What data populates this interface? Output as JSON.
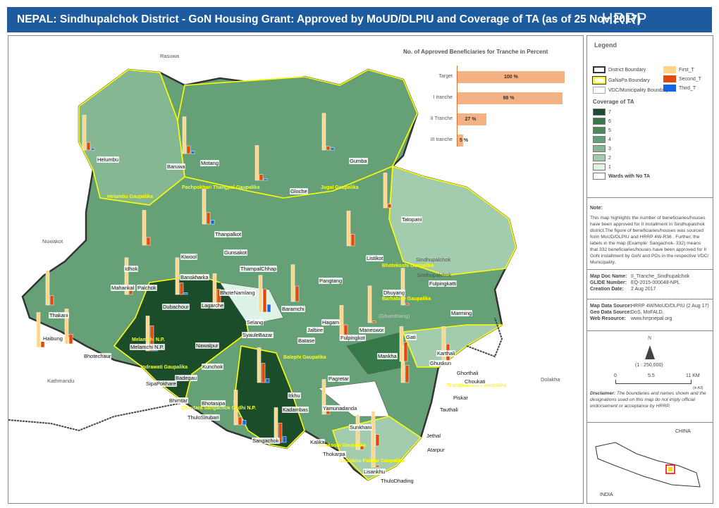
{
  "header": {
    "title": "NEPAL: Sindhupalchok District - GoN Housing Grant: Approved by MoUD/DLPIU and Coverage of TA (as of 25 Nov 2017)",
    "logo": "HRRP"
  },
  "chart_data": {
    "type": "bar",
    "title": "No. of Approved Beneficiaries for Tranche in Percent",
    "categories": [
      "Target",
      "I tranche",
      "II Tranche",
      "III tranche"
    ],
    "values": [
      100,
      98,
      27,
      5
    ],
    "value_labels": [
      "100 %",
      "98 %",
      "27 %",
      "5 %"
    ],
    "orientation": "horizontal",
    "color": "#f4b183",
    "xlim": [
      0,
      100
    ]
  },
  "legend": {
    "title": "Legend",
    "boundaries": [
      "District Boundary",
      "GaNaPa Boundary",
      "VDC/Municipality Boundary"
    ],
    "tranches": [
      {
        "label": "First_T",
        "color": "#ffd58a"
      },
      {
        "label": "Second_T",
        "color": "#e34a0a"
      },
      {
        "label": "Third_T",
        "color": "#1565e0"
      }
    ],
    "coverage_title": "Coverage of TA",
    "coverage": [
      {
        "label": "7",
        "color": "#1b4d2a"
      },
      {
        "label": "6",
        "color": "#357a48"
      },
      {
        "label": "5",
        "color": "#4a8a5c"
      },
      {
        "label": "4",
        "color": "#66a077"
      },
      {
        "label": "3",
        "color": "#85b792"
      },
      {
        "label": "2",
        "color": "#a3cbad"
      },
      {
        "label": "1",
        "color": "#def3e7"
      },
      {
        "label": "Wards with No TA",
        "color": "#ffffff"
      }
    ]
  },
  "note": {
    "title": "Note:",
    "text": "This map highlights the number of beneficiaries/houses have been approved for II installment in Sindhupalchok district.The figure of beneficiaries/houses was sourced form MoUD/DLPIU and HRRP 4W-R36 . Further, the labels in the map (Example: Sangachok- 332) means that 332 beneficiaries/houses have been approved for II GoN installment by GoN and POs in the respective VDC/ Municipality."
  },
  "meta": [
    {
      "k": "Map Doc Name:",
      "v": "II_Tranche_Sindhupalchok"
    },
    {
      "k": "GLIDE Number:",
      "v": "EQ-2015-000048-NPL"
    },
    {
      "k": "Creation Date:",
      "v": "2 Aug 2017"
    }
  ],
  "source": [
    {
      "k": "Map Data Source:",
      "v": "HRRP 4W/MoUD/DLPIU (2 Aug 17)"
    },
    {
      "k": "Geo Data Source:",
      "v": "DoS, MoFALD."
    },
    {
      "k": "Web Resource:",
      "v": "www.hrrpnepal.org"
    }
  ],
  "scale": {
    "north": "N",
    "ratio": "(1 : 250,000)",
    "ticks": [
      "0",
      "5.5",
      "11 KM"
    ],
    "paper": "(in A3)"
  },
  "disclaimer": {
    "title": "Disclaimer:",
    "text": "The boundaries and names shown and the designations used on this map do not imply official endorsement or acceptance by HRRP."
  },
  "inset": {
    "north": "CHINA",
    "south": "INDIA"
  },
  "regions": [
    "Rasuwa",
    "Nuwakot",
    "Kathmandu",
    "Dolakha",
    "Sindhupalchok"
  ],
  "gaunpalikas": [
    "Helambu Gaupalika",
    "Pachpokhari Thangpal Gaupalika",
    "Jugal Gaupalika",
    "Bhotekoshi Gaupalika",
    "Barhabise Gaupalika",
    "Melamchi N.P.",
    "Indrawati Gaupalika",
    "Balephi Gaupalika",
    "Chautara Sangachok Gadhi N.P.",
    "Tripurasundari Gaupalika",
    "Sunkoshi Gaupalika",
    "Lisankhu Pakhar Gaupalika"
  ],
  "vdcs": [
    "Helumbu",
    "Baruwa",
    "Motang",
    "Gumba",
    "Gloche",
    "Tatopani",
    "Thanpalkot",
    "Gunsakot",
    "Kiwool",
    "Listikot",
    "Idhok",
    "ThampalChhap",
    "Banskharka",
    "Pangtang",
    "Fulpingkatti",
    "BhoteNamlang",
    "Mahankal",
    "Palchok",
    "Dhuyang",
    "Dubachour",
    "Lagarche",
    "Baramchi",
    "Marming",
    "Thakani",
    "Selang",
    "Hagam",
    "(Ghumthang)",
    "Maneswor",
    "Jalbire",
    "SyauleBazar",
    "Fulpingkot",
    "Gati",
    "Haibung",
    "Batase",
    "Melamchi N.P.",
    "Nawalpur",
    "Bhotechaur",
    "Mankha",
    "Karthali",
    "Ghuskun",
    "Kunchok",
    "Ghorthali",
    "Badegau",
    "Choukati",
    "SipaPokhare",
    "Pagretar",
    "Piskar",
    "Irkhu",
    "Bhimtar",
    "Bhotasipa",
    "Kadambas",
    "Yamunadanda",
    "Tauthali",
    "ThuloSirubari",
    "Sunkhani",
    "Jethal",
    "Sangachok",
    "Kalika",
    "Atarpur",
    "Thokarpa",
    "Lisankhu",
    "ThuloDhading",
    "Sindhupalchok"
  ],
  "tranche_bars": [
    {
      "vdc": "Helumbu",
      "first": 0.9,
      "second": 0.2,
      "third": 0.05
    },
    {
      "vdc": "Motang",
      "first": 0.95,
      "second": 0.2,
      "third": 0.06
    },
    {
      "vdc": "Gumba",
      "first": 0.95,
      "second": 0.1,
      "third": 0.06
    },
    {
      "vdc": "Gloche",
      "first": 0.9,
      "second": 0.15,
      "third": 0.04
    },
    {
      "vdc": "Tatopani",
      "first": 0.9,
      "second": 0.1,
      "third": 0
    },
    {
      "vdc": "Thanpalkot",
      "first": 0.9,
      "second": 0.3,
      "third": 0.1
    },
    {
      "vdc": "Kiwool",
      "first": 0.9,
      "second": 0.2,
      "third": 0
    },
    {
      "vdc": "Listikot",
      "first": 0.9,
      "second": 0.3,
      "third": 0
    },
    {
      "vdc": "Dubachour",
      "first": 0.95,
      "second": 0.25,
      "third": 0
    },
    {
      "vdc": "Lagarche",
      "first": 0.95,
      "second": 0.3,
      "third": 0.05
    },
    {
      "vdc": "Baramchi",
      "first": 0.95,
      "second": 0.6,
      "third": 0.2
    },
    {
      "vdc": "Selang",
      "first": 0.9,
      "second": 0.5,
      "third": 0
    },
    {
      "vdc": "Hagam",
      "first": 0.95,
      "second": 0.4,
      "third": 0
    },
    {
      "vdc": "Gati",
      "first": 0.95,
      "second": 0.05,
      "third": 0
    },
    {
      "vdc": "Marming",
      "first": 0.95,
      "second": 0.05,
      "third": 0
    },
    {
      "vdc": "Thakani",
      "first": 0.9,
      "second": 0.25,
      "third": 0
    },
    {
      "vdc": "Haibung",
      "first": 0.9,
      "second": 0.15,
      "third": 0
    },
    {
      "vdc": "Bhotechaur",
      "first": 0.9,
      "second": 0.25,
      "third": 0
    },
    {
      "vdc": "Nawalpur",
      "first": 0.9,
      "second": 0.65,
      "third": 0.08
    },
    {
      "vdc": "Mankha",
      "first": 0.9,
      "second": 0.4,
      "third": 0
    },
    {
      "vdc": "Karthali",
      "first": 0.9,
      "second": 0.45,
      "third": 0
    },
    {
      "vdc": "Choukati",
      "first": 0.95,
      "second": 0.45,
      "third": 0
    },
    {
      "vdc": "Irkhu",
      "first": 0.9,
      "second": 0.5,
      "third": 0.1
    },
    {
      "vdc": "Sangachok",
      "first": 0.9,
      "second": 0.2,
      "third": 0.12
    },
    {
      "vdc": "Kalika",
      "first": 0.9,
      "second": 0.5,
      "third": 0.15
    },
    {
      "vdc": "Sunkhani",
      "first": 0.9,
      "second": 0.2,
      "third": 0
    },
    {
      "vdc": "Jethal",
      "first": 0.9,
      "second": 0.3,
      "third": 0
    },
    {
      "vdc": "Lisankhu",
      "first": 0.9,
      "second": 0.1,
      "third": 0
    },
    {
      "vdc": "ThuloDhading",
      "first": 0.95,
      "second": 0.05,
      "third": 0
    },
    {
      "vdc": "Piskar",
      "first": 0.9,
      "second": 0.5,
      "third": 0
    }
  ]
}
